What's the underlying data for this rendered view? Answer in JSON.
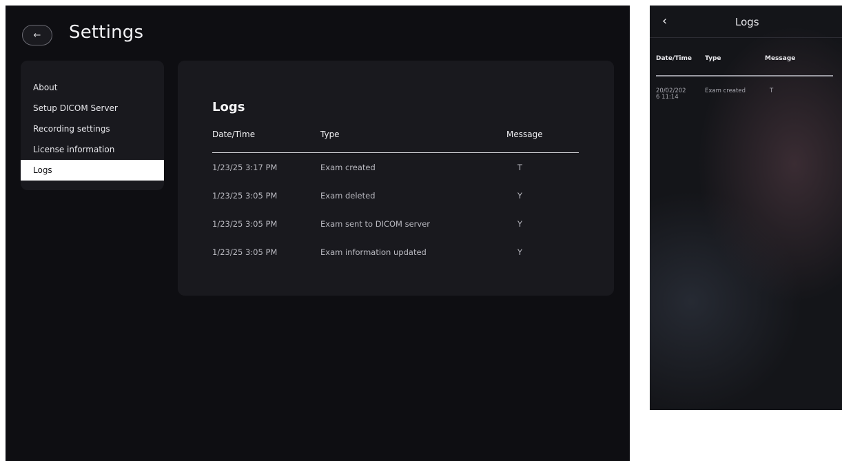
{
  "desktop": {
    "header": {
      "title": "Settings",
      "back_icon": "←"
    },
    "sidebar": {
      "items": [
        {
          "label": "About",
          "active": false
        },
        {
          "label": "Setup DICOM Server",
          "active": false
        },
        {
          "label": "Recording settings",
          "active": false
        },
        {
          "label": "License information",
          "active": false
        },
        {
          "label": "Logs",
          "active": true
        }
      ]
    },
    "logs": {
      "heading": "Logs",
      "columns": [
        "Date/Time",
        "Type",
        "Message"
      ],
      "rows": [
        [
          "1/23/25 3:17 PM",
          "Exam created",
          "T"
        ],
        [
          "1/23/25 3:05 PM",
          "Exam deleted",
          "Y"
        ],
        [
          "1/23/25 3:05 PM",
          "Exam sent to DICOM server",
          "Y"
        ],
        [
          "1/23/25 3:05 PM",
          "Exam information updated",
          "Y"
        ]
      ]
    }
  },
  "mobile": {
    "header": {
      "title": "Logs",
      "back_icon": "‹"
    },
    "columns": [
      "Date/Time",
      "Type",
      "Message"
    ],
    "rows": [
      [
        "20/02/2026 11:14",
        "Exam created",
        "T"
      ]
    ]
  },
  "colors": {
    "background": "#0e0e12",
    "card": "#19191e",
    "active_item_bg": "#ffffff"
  }
}
